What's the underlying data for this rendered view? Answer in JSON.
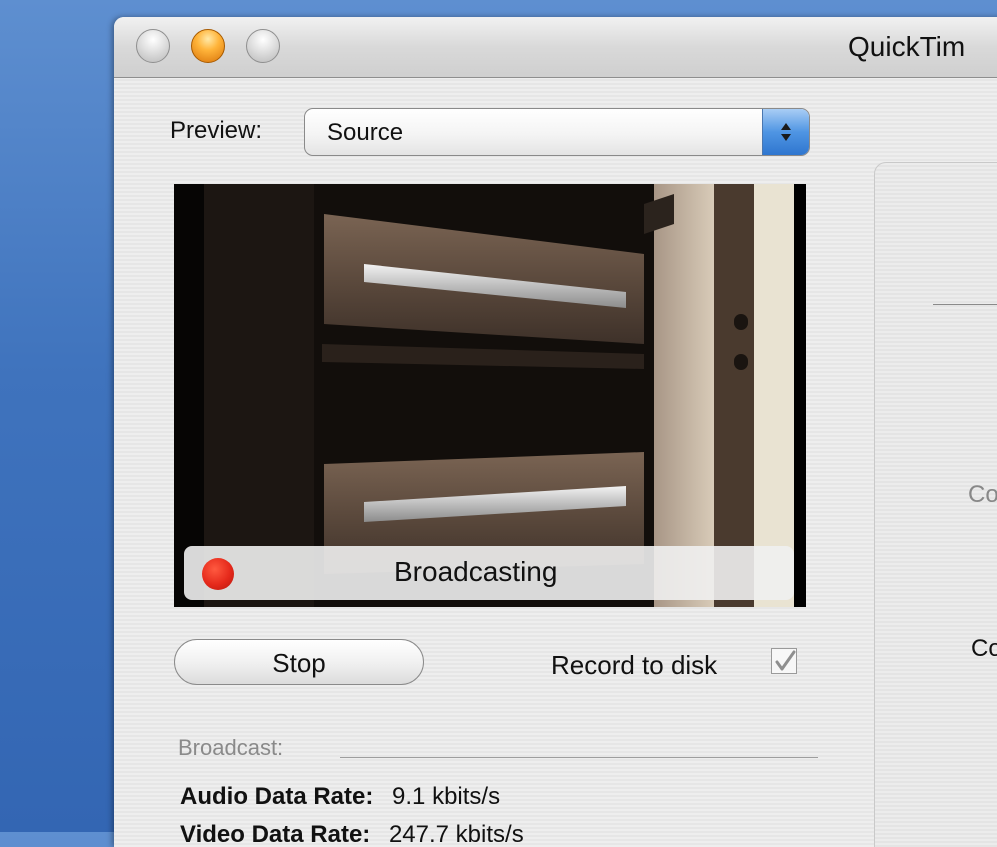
{
  "window": {
    "title": "QuickTim"
  },
  "preview": {
    "label": "Preview:",
    "selected": "Source",
    "status": "Broadcasting"
  },
  "controls": {
    "stop_label": "Stop",
    "record_label": "Record to disk",
    "record_checked": true
  },
  "broadcast": {
    "section_label": "Broadcast:",
    "audio_label": "Audio Data Rate:",
    "audio_value": "9.1 kbits/s",
    "video_label": "Video Data Rate:",
    "video_value": "247.7 kbits/s"
  },
  "right_panel": {
    "truncated_label_1": "Co",
    "truncated_label_2": "Co"
  },
  "colors": {
    "desktop": "#3f73bd",
    "record_dot": "#e5291b",
    "stepper_blue": "#4f95e3"
  }
}
